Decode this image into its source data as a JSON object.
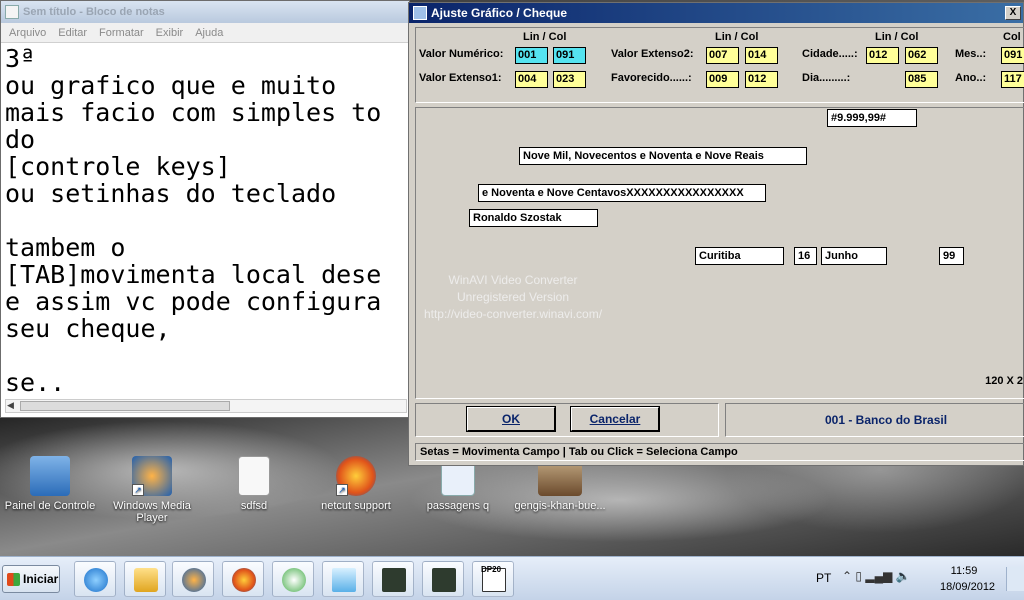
{
  "notepad": {
    "title": "Sem título - Bloco de notas",
    "menu": [
      "Arquivo",
      "Editar",
      "Formatar",
      "Exibir",
      "Ajuda"
    ],
    "content": "3ª\nou grafico que e muito\nmais facio com simples to\ndo\n[controle keys]\nou setinhas do teclado\n\ntambem o\n[TAB]movimenta local dese\ne assim vc pode configura\nseu cheque,\n\nse.."
  },
  "dialog": {
    "title": "Ajuste Gráfico / Cheque",
    "lincol_header": "Lin / Col",
    "fields": [
      {
        "label": "Valor Numérico:",
        "lin": "001",
        "col": "091"
      },
      {
        "label": "Valor Extenso1:",
        "lin": "004",
        "col": "023"
      },
      {
        "label": "Valor Extenso2:",
        "lin": "007",
        "col": "014"
      },
      {
        "label": "Favorecido......:",
        "lin": "009",
        "col": "012"
      },
      {
        "label": "Cidade.....:",
        "lin": "012",
        "col": "062"
      },
      {
        "label": "Dia.........:",
        "lin": "",
        "col": "085"
      },
      {
        "label": "Mes..:",
        "lin": "091"
      },
      {
        "label": "Ano..:",
        "lin": "117"
      }
    ],
    "col_partial": "Col",
    "check": {
      "valor_numerico": "#9.999,99#",
      "extenso1": "Nove Mil, Novecentos e Noventa e Nove Reais",
      "extenso2": "e Noventa e Nove CentavosXXXXXXXXXXXXXXXX",
      "favorecido": "Ronaldo Szostak",
      "cidade": "Curitiba",
      "dia": "16",
      "mes": "Junho",
      "ano": "99"
    },
    "size_label": "120 X 2",
    "ok_label": "OK",
    "cancel_label": "Cancelar",
    "bank": "001 - Banco do Brasil",
    "status": "Setas = Movimenta Campo | Tab ou Click = Seleciona Campo",
    "close_glyph": "X"
  },
  "watermark": [
    "WinAVI Video Converter",
    "Unregistered Version",
    "http://video-converter.winavi.com/"
  ],
  "desktop_icons": [
    {
      "label": "Painel de Controle",
      "icon": "control-panel-icon"
    },
    {
      "label": "Windows Media Player",
      "icon": "media-player-icon"
    },
    {
      "label": "sdfsd",
      "icon": "text-file-icon"
    },
    {
      "label": "netcut support",
      "icon": "firefox-shortcut-icon"
    },
    {
      "label": "passagens q",
      "icon": "document-icon"
    },
    {
      "label": "gengis-khan-bue...",
      "icon": "image-file-icon"
    }
  ],
  "taskbar": {
    "start_label": "Iniciar",
    "pinned": [
      "internet-explorer-icon",
      "explorer-folder-icon",
      "media-player-icon",
      "firefox-icon",
      "talk-icon",
      "notepad-icon",
      "terminal-icon",
      "terminal-record-icon",
      "dp20-icon"
    ],
    "dp20_label": "DP20",
    "language": "PT",
    "time": "11:59",
    "date": "18/09/2012"
  },
  "colors": {
    "field_yellow": "#ffff99",
    "field_selected": "#55e3f0",
    "title_blue": "#0a246a"
  }
}
